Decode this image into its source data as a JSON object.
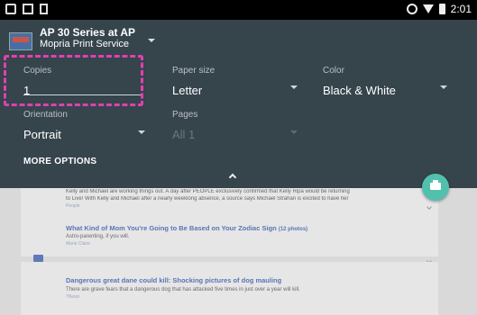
{
  "status_bar": {
    "time": "2:01"
  },
  "printer": {
    "name": "AP 30 Series at AP",
    "service": "Mopria Print Service"
  },
  "copies": {
    "label": "Copies",
    "value": "1"
  },
  "paper_size": {
    "label": "Paper size",
    "value": "Letter"
  },
  "color": {
    "label": "Color",
    "value": "Black & White"
  },
  "orientation": {
    "label": "Orientation",
    "value": "Portrait"
  },
  "pages": {
    "label": "Pages",
    "value": "All 1"
  },
  "more_options": "MORE OPTIONS",
  "document": {
    "snippet_line1": "Kelly and Michael are working things out. A day after PEOPLE exclusively confirmed that Kelly Ripa would be returning",
    "snippet_line2": "to Live! With Kelly and Michael after a nearly weeklong absence, a source says Michael Strahan is excited to have her",
    "snippet_source": "People",
    "story1": {
      "title": "What Kind of Mom You're Going to Be Based on Your Zodiac Sign",
      "count": "(12 photos)",
      "subtitle": "Astro-parenting, if you will.",
      "source": "Marie Claire"
    },
    "story2": {
      "title": "Dangerous great dane could kill: Shocking pictures of dog mauling",
      "subtitle": "There are grave fears that a dangerous dog that has attacked five times in just over a year will kill.",
      "source": "7News"
    }
  },
  "colors": {
    "panel": "#36444c",
    "fab": "#53c0ae",
    "highlight": "#e040b0",
    "link": "#5876b4"
  }
}
